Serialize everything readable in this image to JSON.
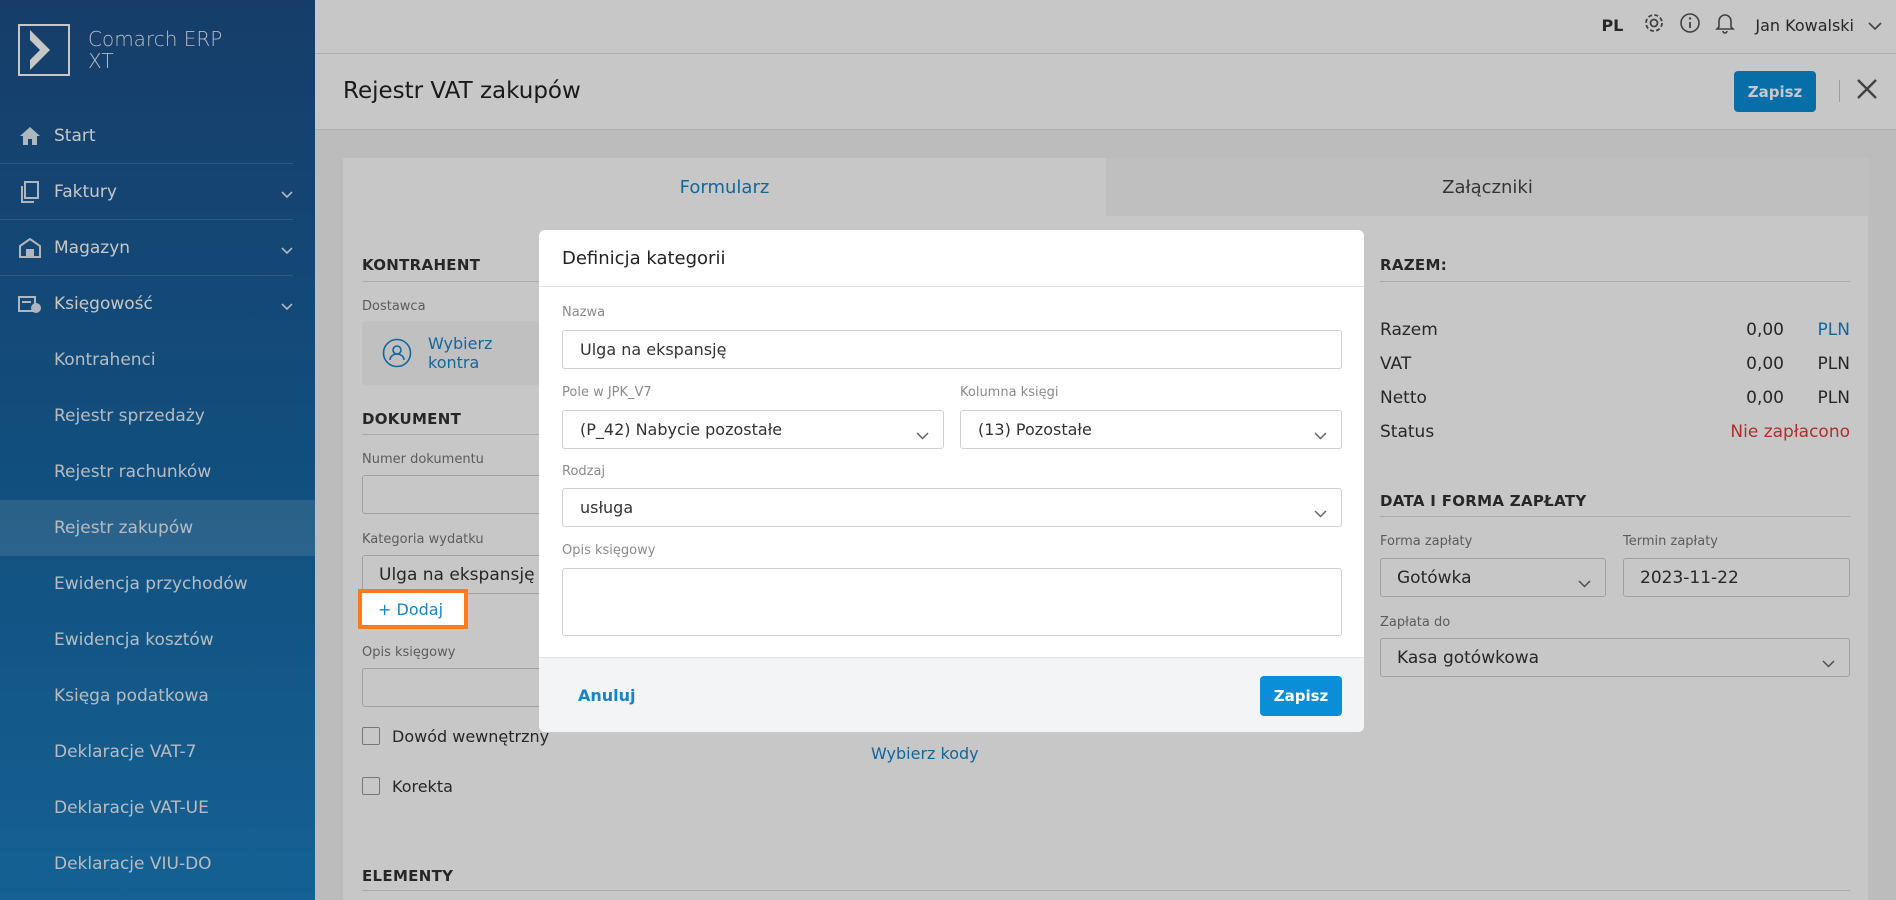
{
  "app": {
    "name_line1": "Comarch ERP",
    "name_line2": "XT"
  },
  "sidebar": {
    "items": [
      {
        "label": "Start",
        "icon": "home-icon"
      },
      {
        "label": "Faktury",
        "icon": "document-icon"
      },
      {
        "label": "Magazyn",
        "icon": "warehouse-icon"
      },
      {
        "label": "Księgowość",
        "icon": "accounting-icon"
      }
    ],
    "subitems": [
      {
        "label": "Kontrahenci"
      },
      {
        "label": "Rejestr sprzedaży"
      },
      {
        "label": "Rejestr rachunków"
      },
      {
        "label": "Rejestr zakupów"
      },
      {
        "label": "Ewidencja przychodów"
      },
      {
        "label": "Ewidencja kosztów"
      },
      {
        "label": "Księga podatkowa"
      },
      {
        "label": "Deklaracje VAT-7"
      },
      {
        "label": "Deklaracje VAT-UE"
      },
      {
        "label": "Deklaracje VIU-DO"
      }
    ]
  },
  "topbar": {
    "lang": "PL",
    "user": "Jan Kowalski"
  },
  "page": {
    "title": "Rejestr VAT zakupów",
    "save_label": "Zapisz"
  },
  "tabs": {
    "form": "Formularz",
    "attachments": "Załączniki"
  },
  "form": {
    "kontrahent_title": "KONTRAHENT",
    "dostawca_label": "Dostawca",
    "dostawca_placeholder": "Wybierz kontra",
    "dokument_title": "DOKUMENT",
    "numer_label": "Numer dokumentu",
    "kategoria_label": "Kategoria wydatku",
    "kategoria_value": "Ulga na ekspansję",
    "dodaj_label": "Dodaj",
    "opis_label": "Opis księgowy",
    "dowod_label": "Dowód wewnętrzny",
    "korekta_label": "Korekta",
    "wybierz_kody": "Wybierz kody",
    "elementy_title": "ELEMENTY"
  },
  "summary": {
    "title": "RAZEM:",
    "rows": [
      {
        "label": "Razem",
        "value": "0,00",
        "currency": "PLN"
      },
      {
        "label": "VAT",
        "value": "0,00",
        "currency": "PLN"
      },
      {
        "label": "Netto",
        "value": "0,00",
        "currency": "PLN"
      }
    ],
    "status_label": "Status",
    "status_value": "Nie zapłacono",
    "status_color": "#e23b3b",
    "payment_title": "DATA I FORMA ZAPŁATY",
    "forma_label": "Forma zapłaty",
    "forma_value": "Gotówka",
    "termin_label": "Termin zapłaty",
    "termin_value": "2023-11-22",
    "zaplata_do_label": "Zapłata do",
    "zaplata_do_value": "Kasa gotówkowa"
  },
  "modal": {
    "title": "Definicja kategorii",
    "nazwa_label": "Nazwa",
    "nazwa_value": "Ulga na ekspansję",
    "pole_label": "Pole w JPK_V7",
    "pole_value": "(P_42) Nabycie pozostałe",
    "kolumna_label": "Kolumna księgi",
    "kolumna_value": "(13) Pozostałe",
    "rodzaj_label": "Rodzaj",
    "rodzaj_value": "usługa",
    "opis_label": "Opis księgowy",
    "cancel_label": "Anuluj",
    "save_label": "Zapisz"
  },
  "colors": {
    "accent": "#0a8ed8",
    "link": "#1884c7",
    "highlight": "#ff7a1a"
  }
}
